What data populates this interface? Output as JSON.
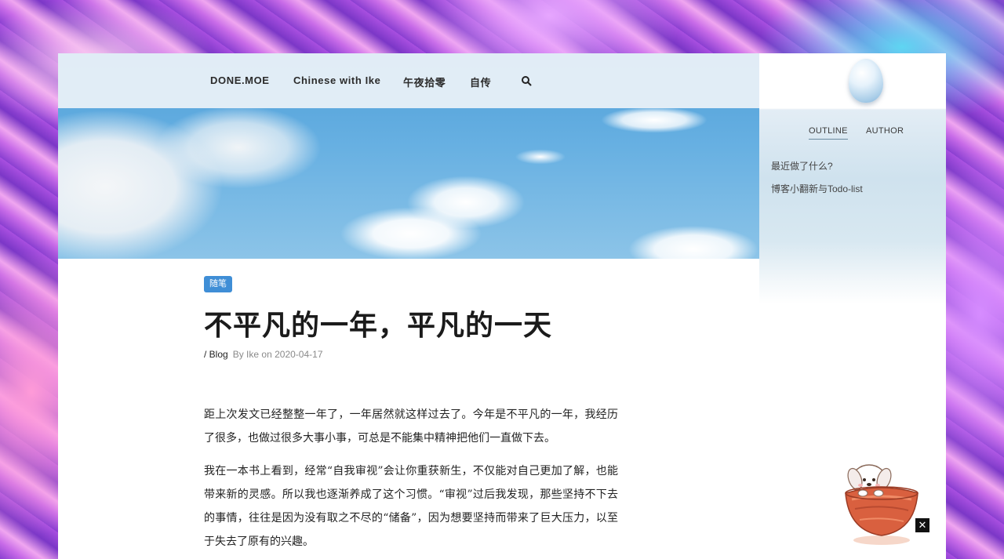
{
  "nav": {
    "items": [
      "DONE.MOE",
      "Chinese with Ike",
      "午夜拾零",
      "自传"
    ],
    "search_icon": "search-icon"
  },
  "sidebar": {
    "avatar_icon": "egg-avatar",
    "tabs": [
      "OUTLINE",
      "AUTHOR"
    ],
    "active_tab": "OUTLINE",
    "outline": [
      "最近做了什么?",
      "博客小翻新与Todo-list"
    ]
  },
  "post": {
    "category": "随笔",
    "title": "不平凡的一年，平凡的一天",
    "breadcrumb": "/ Blog",
    "by_label": "By",
    "author": "Ike",
    "on_label": "on",
    "date": "2020-04-17",
    "paragraphs": [
      "距上次发文已经整整一年了，一年居然就这样过去了。今年是不平凡的一年，我经历了很多，也做过很多大事小事，可总是不能集中精神把他们一直做下去。",
      "我在一本书上看到，经常“自我审视”会让你重获新生，不仅能对自己更加了解，也能带来新的灵感。所以我也逐渐养成了这个习惯。“审视”过后我发现，那些坚持不下去的事情，往往是因为没有取之不尽的“储备”，因为想要坚持而带来了巨大压力，以至于失去了原有的兴趣。"
    ]
  },
  "widget": {
    "mascot_icon": "dog-in-bowl-mascot",
    "close_label": "✕"
  },
  "colors": {
    "badge": "#3f8ed6",
    "text": "#222222"
  }
}
